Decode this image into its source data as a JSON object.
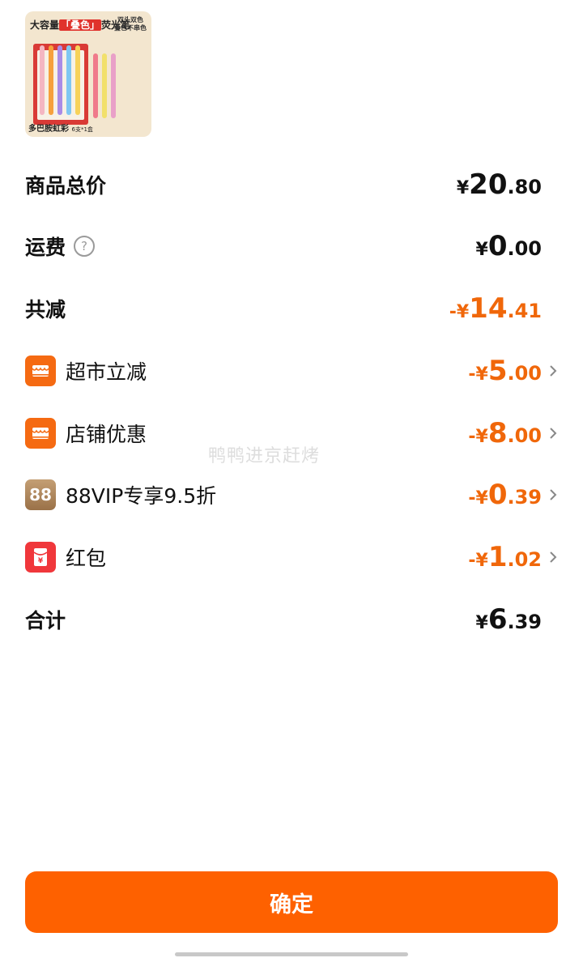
{
  "product": {
    "image_top_text_prefix": "大容量",
    "image_top_text_highlight": "「叠色」",
    "image_top_text_suffix": "荧光笔",
    "image_top_right_line1": "双头双色",
    "image_top_right_line2": "叠色不串色",
    "image_bottom_text": "多巴胺虹彩",
    "image_bottom_small": "6支*1盒",
    "pen_colors": [
      "#f4b6c2",
      "#f6a03c",
      "#a98be6",
      "#7fc7f2",
      "#f7d25a",
      "#f07a8a",
      "#f2e06b",
      "#e9a0c8"
    ]
  },
  "summary": {
    "total": {
      "label": "商品总价",
      "currency": "¥",
      "int": "20",
      "dec": ".80"
    },
    "shipping": {
      "label": "运费",
      "help_glyph": "?",
      "currency": "¥",
      "int": "0",
      "dec": ".00"
    },
    "reduction": {
      "label": "共减",
      "currency": "-¥",
      "int": "14",
      "dec": ".41"
    }
  },
  "discounts": [
    {
      "label": "超市立减",
      "currency": "-¥",
      "int": "5",
      "dec": ".00",
      "icon": "supermarket-icon"
    },
    {
      "label": "店铺优惠",
      "currency": "-¥",
      "int": "8",
      "dec": ".00",
      "icon": "store-icon"
    },
    {
      "label": "88VIP专享9.5折",
      "currency": "-¥",
      "int": "0",
      "dec": ".39",
      "icon": "vip88-icon",
      "icon_text": "88"
    },
    {
      "label": "红包",
      "currency": "-¥",
      "int": "1",
      "dec": ".02",
      "icon": "red-packet-icon",
      "icon_text": "¥"
    }
  ],
  "grand_total": {
    "label": "合计",
    "currency": "¥",
    "int": "6",
    "dec": ".39"
  },
  "watermark": "鸭鸭进京赶烤",
  "confirm_label": "确定",
  "colors": {
    "accent": "#fe6100",
    "discount_text": "#f0670a"
  }
}
